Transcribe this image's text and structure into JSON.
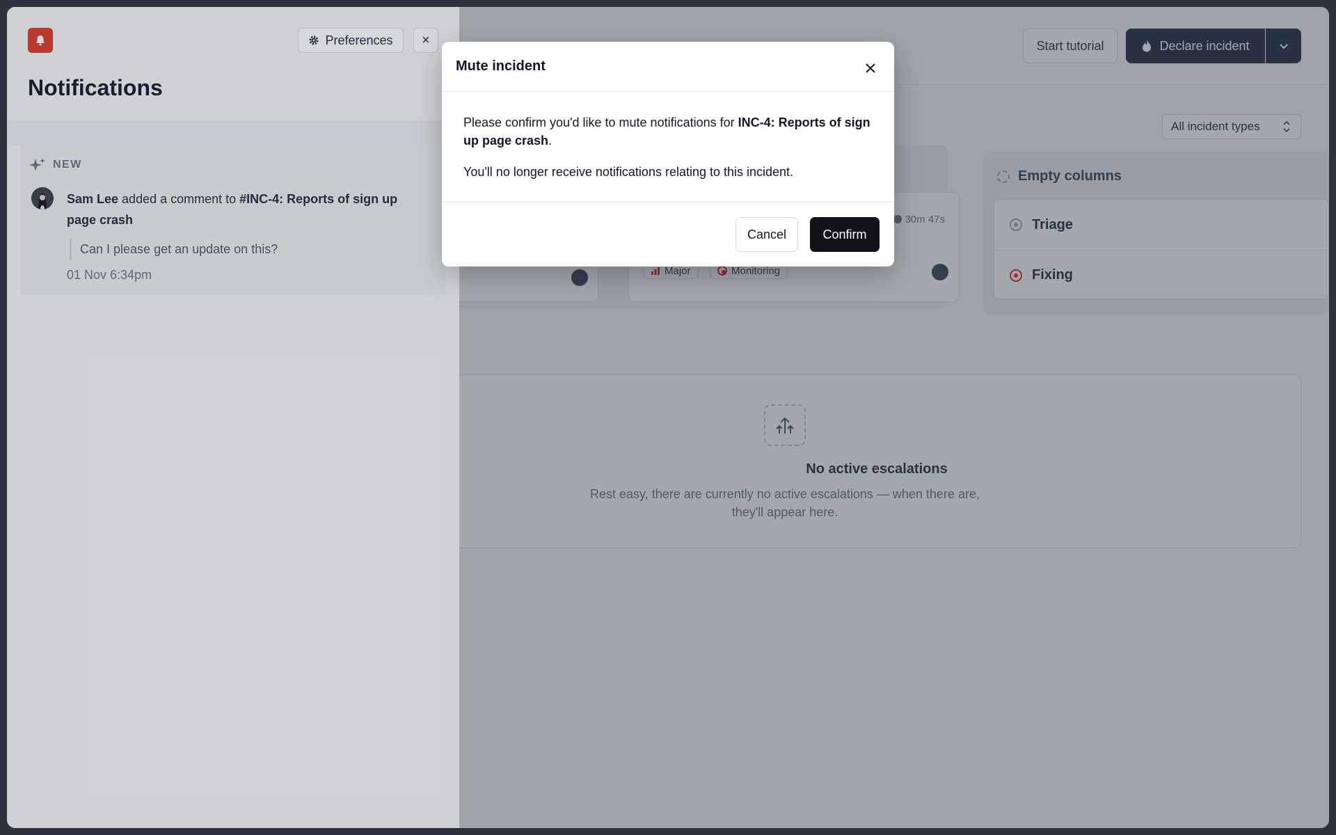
{
  "background": {
    "header": {
      "tutorial_label": "Start tutorial",
      "declare_label": "Declare incident"
    },
    "filter": {
      "selected": "All incident types"
    },
    "incident_cards": [
      {
        "timer": "30m 47s",
        "severity": "Major",
        "status": "Monitoring"
      }
    ],
    "empty_columns": {
      "title": "Empty columns",
      "items": [
        {
          "label": "Triage",
          "color": "#9ca3af"
        },
        {
          "label": "Fixing",
          "color": "#dc2626"
        }
      ]
    },
    "escalations": {
      "title": "No active escalations",
      "description": "Rest easy, there are currently no active escalations — when there are, they'll appear here."
    }
  },
  "notifications": {
    "preferences_label": "Preferences",
    "close_label": "×",
    "title": "Notifications",
    "section_label": "NEW",
    "items": [
      {
        "author": "Sam Lee",
        "action": " added a comment to ",
        "target": "#INC-4: Reports of sign up page crash",
        "quote": "Can I please get an update on this?",
        "time": "01 Nov 6:34pm"
      }
    ]
  },
  "modal": {
    "title": "Mute incident",
    "text_prefix": "Please confirm you'd like to mute notifications for ",
    "text_incident": "INC-4: Reports of sign up page crash",
    "text_suffix": ".",
    "text_secondary": "You'll no longer receive notifications relating to this incident.",
    "cancel_label": "Cancel",
    "confirm_label": "Confirm"
  },
  "colors": {
    "brand_red": "#d93a25",
    "primary_dark": "#1f2937",
    "confirm_bg": "#111318"
  }
}
